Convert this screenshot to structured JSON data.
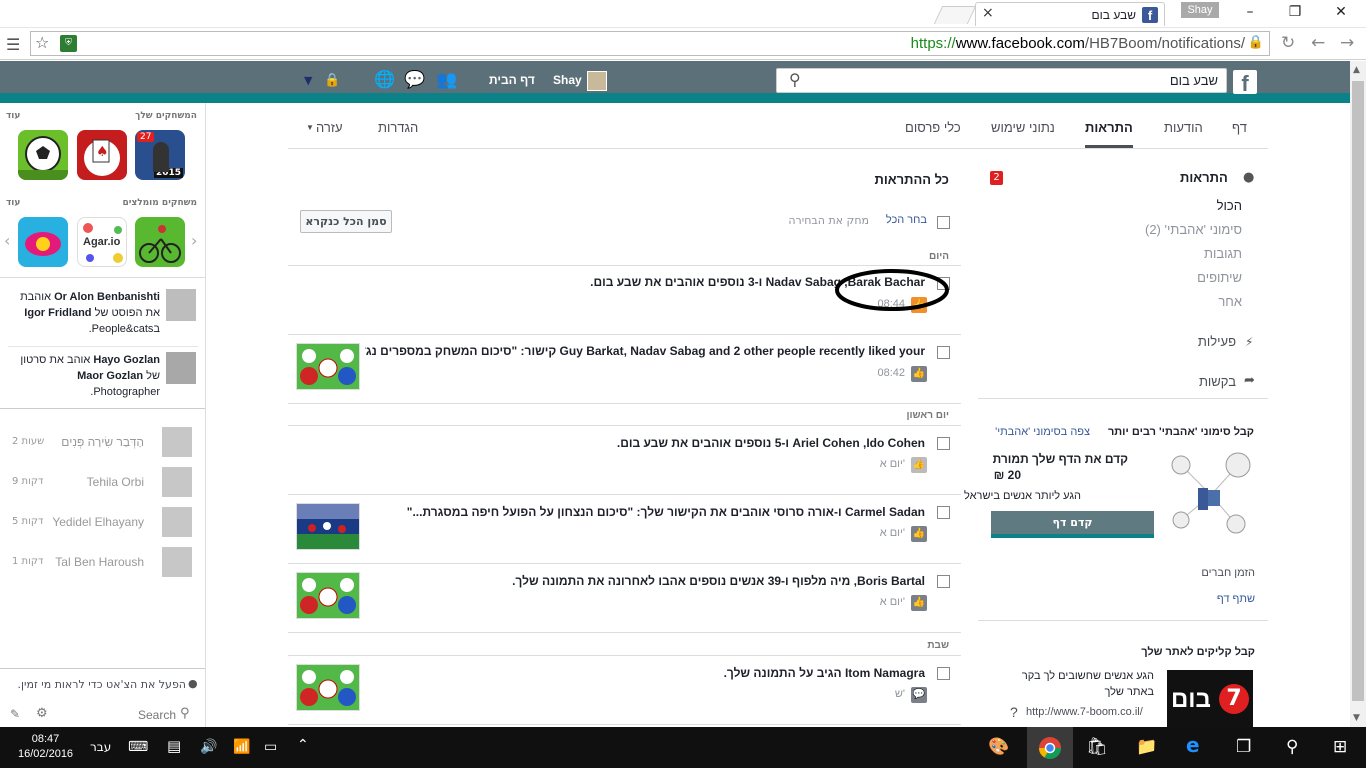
{
  "browser": {
    "tab_title": "שבע בום",
    "user_badge": "Shay",
    "url_https": "https://",
    "url_domain": "www.facebook.com",
    "url_path": "/HB7Boom/notifications/"
  },
  "fbbar": {
    "search_value": "שבע בום",
    "user_name": "Shay",
    "home_label": "דף הבית"
  },
  "pagenav": {
    "tabs": [
      "דף",
      "הודעות",
      "התראות",
      "נתוני שימוש",
      "כלי פרסום",
      "הגדרות",
      "עזרה"
    ]
  },
  "rightmenu": {
    "notifications_title": "התראות",
    "badge": "2",
    "subitems": [
      "הכול",
      "סימוני 'אהבתי' (2)",
      "תגובות",
      "שיתופים",
      "אחר"
    ],
    "activity": "פעילות",
    "requests": "בקשות"
  },
  "main": {
    "title": "כל ההתראות",
    "select_all": "בחר הכל",
    "clear_selection": "מחק את הבחירה",
    "mark_read": "סמן הכל כנקרא",
    "days": [
      "היום",
      "יום ראשון",
      "שבת"
    ],
    "rows": [
      {
        "text": "Nadav Sabag ,Barak Bachar ו-3 נוספים אוהבים את שבע בום.",
        "time": "08:44"
      },
      {
        "text": "Guy Barkat, Nadav Sabag and 2 other people recently liked your קישור: \"סיכום המשחק במספרים נגד...",
        "time": "08:42"
      },
      {
        "text": "Ariel Cohen ,Ido Cohen ו-5 נוספים אוהבים את שבע בום.",
        "time": "יום א'"
      },
      {
        "text": "Carmel Sadan ו-אורה סרוסי אוהבים את הקישור שלך: \"סיכום הנצחון על הפועל חיפה במסגרת...\"",
        "time": "יום א'"
      },
      {
        "text": "Boris Bartal, מיה מלפוף ו-39 אנשים נוספים אהבו לאחרונה את התמונה שלך.",
        "time": "יום א'"
      },
      {
        "text": "Itom Namagra הגיב על התמונה שלך.",
        "time": "ש'"
      }
    ]
  },
  "leftside": {
    "games_header": "המשחקים שלך",
    "more": "עוד",
    "suggested_header": "משחקים מומלצים",
    "game_badge": "27",
    "game_year": "2015",
    "agario": "Agar.io",
    "feed": [
      {
        "bold": "Or Alon Benbanishti",
        "rest": " אוהבת את הפוסט של ",
        "bold2": "Igor Fridland",
        "rest2": " בPeople&cats."
      },
      {
        "bold": "Hayo Gozlan",
        "rest": " אוהב את סרטון של ",
        "bold2": "Maor Gozlan",
        "rest2": " Photographer."
      }
    ],
    "chat": [
      {
        "name": "הַדְּבַר שִׂירַה פְּנִים",
        "time": "2 שעות"
      },
      {
        "name": "Tehila Orbi",
        "time": "9 דקות"
      },
      {
        "name": "Yedidel Elhayany",
        "time": "5 דקות"
      },
      {
        "name": "Tal Ben Haroush",
        "time": "1 דקות"
      }
    ],
    "chat_enable": "הפעל את הצ'אט כדי לראות מי זמין.",
    "search": "Search"
  },
  "ads": {
    "likes_title": "קבל סימוני 'אהבתי' רבים יותר",
    "likes_link": "צפה בסימוני 'אהבתי'",
    "promo_text": "קדם את הדף שלך תמורת",
    "promo_price": "20 ₪",
    "promo_sub": "הגע ליותר אנשים בישראל",
    "promo_button": "קדם דף",
    "invite": "הזמן חברים",
    "share": "שתף דף",
    "clicks_title": "קבל קליקים לאתר שלך",
    "clicks_text1": "הגע אנשים שחשובים לך בקר",
    "clicks_text2": "באתר שלך",
    "clicks_url": "http://www.7-boom.co.il/",
    "logo_text": "בום",
    "logo_num": "7"
  },
  "taskbar": {
    "time": "08:47",
    "date": "16/02/2016",
    "lang": "עבר"
  },
  "colors": {
    "fb_bar": "#5b7079",
    "teal": "#0a8287",
    "badge_red": "#e02020",
    "promo_button": "#5f7a80"
  }
}
